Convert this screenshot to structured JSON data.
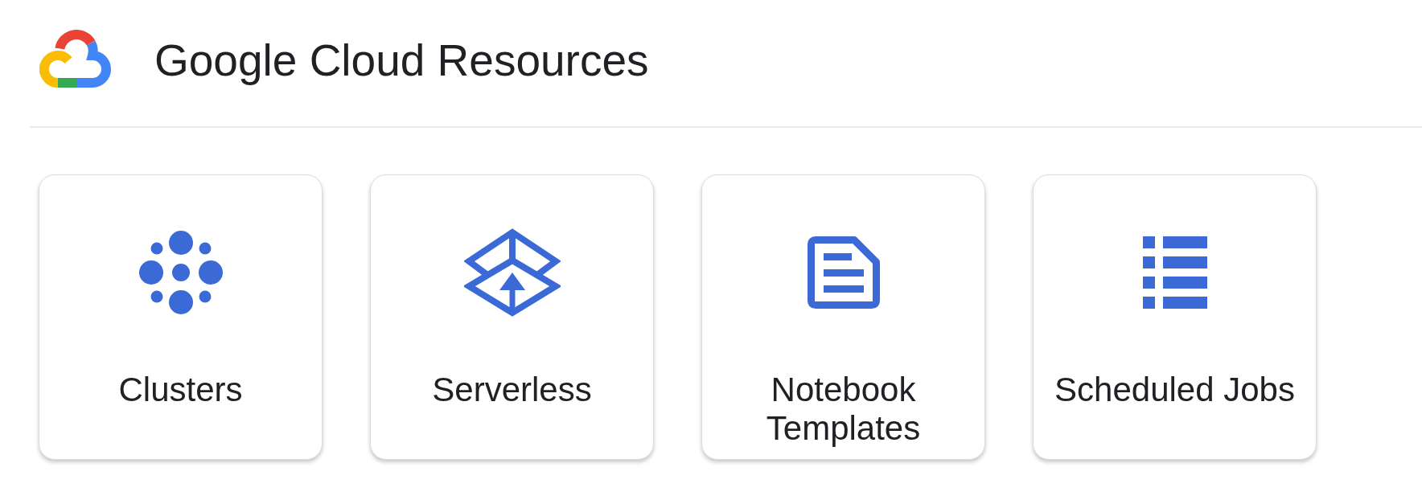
{
  "header": {
    "title": "Google Cloud Resources"
  },
  "cards": [
    {
      "kind": "clusters",
      "label": "Clusters"
    },
    {
      "kind": "serverless",
      "label": "Serverless"
    },
    {
      "kind": "notebook",
      "label": "Notebook Templates"
    },
    {
      "kind": "jobs",
      "label": "Scheduled Jobs"
    }
  ]
}
